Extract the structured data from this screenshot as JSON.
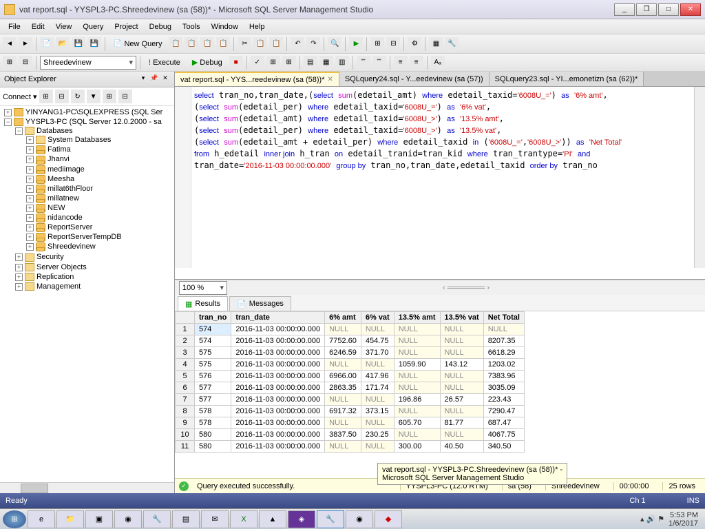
{
  "window_title": "vat report.sql - YYSPL3-PC.Shreedevinew (sa (58))* - Microsoft SQL Server Management Studio",
  "menus": [
    "File",
    "Edit",
    "View",
    "Query",
    "Project",
    "Debug",
    "Tools",
    "Window",
    "Help"
  ],
  "toolbar": {
    "new_query": "New Query",
    "db_combo": "Shreedevinew",
    "execute": "Execute",
    "debug": "Debug"
  },
  "explorer": {
    "title": "Object Explorer",
    "connect": "Connect ▾",
    "servers": [
      {
        "label": "YINYANG1-PC\\SQLEXPRESS (SQL Ser",
        "expanded": false
      },
      {
        "label": "YYSPL3-PC (SQL Server 12.0.2000 - sa",
        "expanded": true
      }
    ],
    "folders_top": "Databases",
    "sysdb": "System Databases",
    "dbs": [
      "Fatima",
      "Jhanvi",
      "mediimage",
      "Meesha",
      "millat6thFloor",
      "millatnew",
      "NEW",
      "nidancode",
      "ReportServer",
      "ReportServerTempDB",
      "Shreedevinew"
    ],
    "folders_bottom": [
      "Security",
      "Server Objects",
      "Replication",
      "Management"
    ]
  },
  "tabs": [
    {
      "label": "vat report.sql - YYS...reedevinew (sa (58))*",
      "active": true,
      "close": true
    },
    {
      "label": "SQLquery24.sql - Y...eedevinew (sa (57))",
      "active": false,
      "close": false
    },
    {
      "label": "SQLquery23.sql - YI...emonetizn (sa (62))*",
      "active": false,
      "close": false
    }
  ],
  "zoom": "100 %",
  "results": {
    "tabs": [
      "Results",
      "Messages"
    ],
    "headers": [
      "",
      "tran_no",
      "tran_date",
      "6% amt",
      "6% vat",
      "13.5% amt",
      "13.5% vat",
      "Net Total"
    ],
    "rows": [
      [
        "1",
        "574",
        "2016-11-03 00:00:00.000",
        "NULL",
        "NULL",
        "NULL",
        "NULL",
        "NULL"
      ],
      [
        "2",
        "574",
        "2016-11-03 00:00:00.000",
        "7752.60",
        "454.75",
        "NULL",
        "NULL",
        "8207.35"
      ],
      [
        "3",
        "575",
        "2016-11-03 00:00:00.000",
        "6246.59",
        "371.70",
        "NULL",
        "NULL",
        "6618.29"
      ],
      [
        "4",
        "575",
        "2016-11-03 00:00:00.000",
        "NULL",
        "NULL",
        "1059.90",
        "143.12",
        "1203.02"
      ],
      [
        "5",
        "576",
        "2016-11-03 00:00:00.000",
        "6966.00",
        "417.96",
        "NULL",
        "NULL",
        "7383.96"
      ],
      [
        "6",
        "577",
        "2016-11-03 00:00:00.000",
        "2863.35",
        "171.74",
        "NULL",
        "NULL",
        "3035.09"
      ],
      [
        "7",
        "577",
        "2016-11-03 00:00:00.000",
        "NULL",
        "NULL",
        "196.86",
        "26.57",
        "223.43"
      ],
      [
        "8",
        "578",
        "2016-11-03 00:00:00.000",
        "6917.32",
        "373.15",
        "NULL",
        "NULL",
        "7290.47"
      ],
      [
        "9",
        "578",
        "2016-11-03 00:00:00.000",
        "NULL",
        "NULL",
        "605.70",
        "81.77",
        "687.47"
      ],
      [
        "10",
        "580",
        "2016-11-03 00:00:00.000",
        "3837.50",
        "230.25",
        "NULL",
        "NULL",
        "4067.75"
      ],
      [
        "11",
        "580",
        "2016-11-03 00:00:00.000",
        "NULL",
        "NULL",
        "300.00",
        "40.50",
        "340.50"
      ]
    ]
  },
  "qstatus": {
    "msg": "Query executed successfully.",
    "server": "YYSPL3-PC (12.0 RTM)",
    "user": "sa (58)",
    "db": "Shreedevinew",
    "time": "00:00:00",
    "rows": "25 rows"
  },
  "tooltip": "vat report.sql - YYSPL3-PC.Shreedevinew (sa (58))* -\nMicrosoft SQL Server Management Studio",
  "status": {
    "ready": "Ready",
    "col": "Ch 1",
    "ins": "INS"
  },
  "tray": {
    "time": "5:53 PM",
    "date": "1/6/2017"
  }
}
